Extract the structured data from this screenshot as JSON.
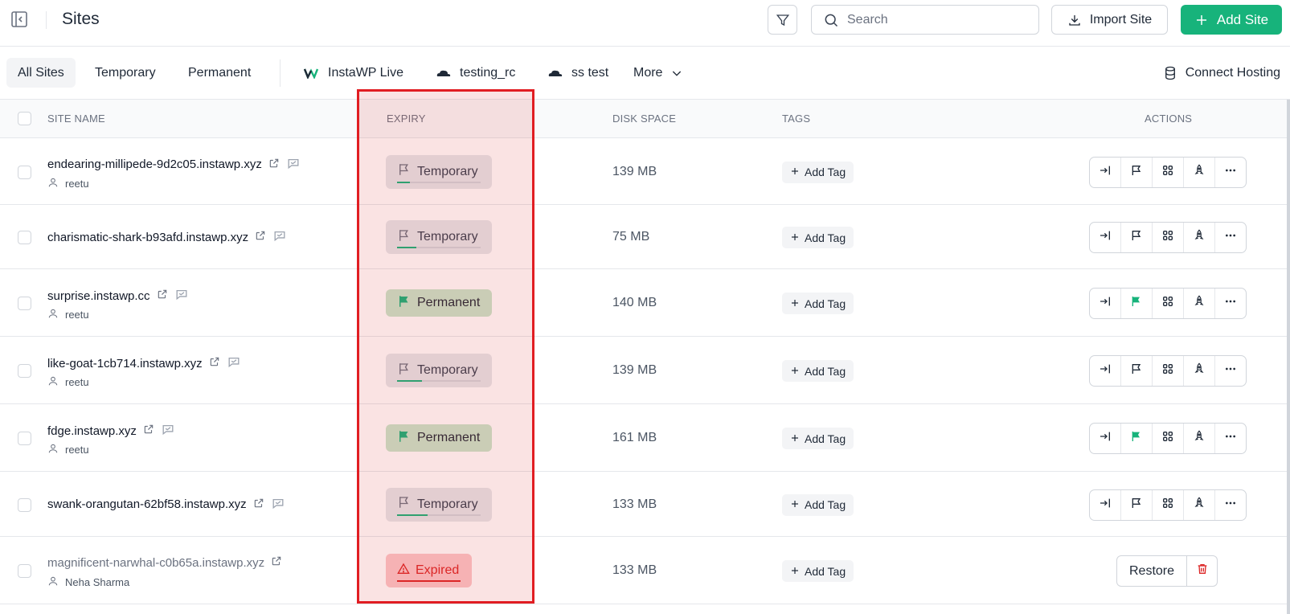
{
  "header": {
    "title": "Sites",
    "search_placeholder": "Search",
    "import_label": "Import Site",
    "add_label": "Add Site",
    "accent_color": "#17b37b"
  },
  "tabs": {
    "all": "All Sites",
    "temporary": "Temporary",
    "permanent": "Permanent",
    "instawp_live": "InstaWP Live",
    "testing_rc": "testing_rc",
    "ss_test": "ss test",
    "more": "More",
    "connect_hosting": "Connect Hosting"
  },
  "columns": {
    "site_name": "SITE NAME",
    "expiry": "EXPIRY",
    "disk_space": "DISK SPACE",
    "tags": "TAGS",
    "actions": "ACTIONS"
  },
  "add_tag_label": "Add Tag",
  "restore_label": "Restore",
  "rows": [
    {
      "name": "endearing-millipede-9d2c05.instawp.xyz",
      "owner": "reetu",
      "expiry": "Temporary",
      "expiry_progress": 0.15,
      "disk": "139 MB"
    },
    {
      "name": "charismatic-shark-b93afd.instawp.xyz",
      "owner": "",
      "expiry": "Temporary",
      "expiry_progress": 0.23,
      "disk": "75 MB"
    },
    {
      "name": "surprise.instawp.cc",
      "owner": "reetu",
      "expiry": "Permanent",
      "disk": "140 MB"
    },
    {
      "name": "like-goat-1cb714.instawp.xyz",
      "owner": "reetu",
      "expiry": "Temporary",
      "expiry_progress": 0.3,
      "disk": "139 MB"
    },
    {
      "name": "fdge.instawp.xyz",
      "owner": "reetu",
      "expiry": "Permanent",
      "disk": "161 MB"
    },
    {
      "name": "swank-orangutan-62bf58.instawp.xyz",
      "owner": "",
      "expiry": "Temporary",
      "expiry_progress": 0.37,
      "disk": "133 MB"
    },
    {
      "name": "magnificent-narwhal-c0b65a.instawp.xyz",
      "owner": "Neha Sharma",
      "expiry": "Expired",
      "disk": "133 MB"
    }
  ]
}
